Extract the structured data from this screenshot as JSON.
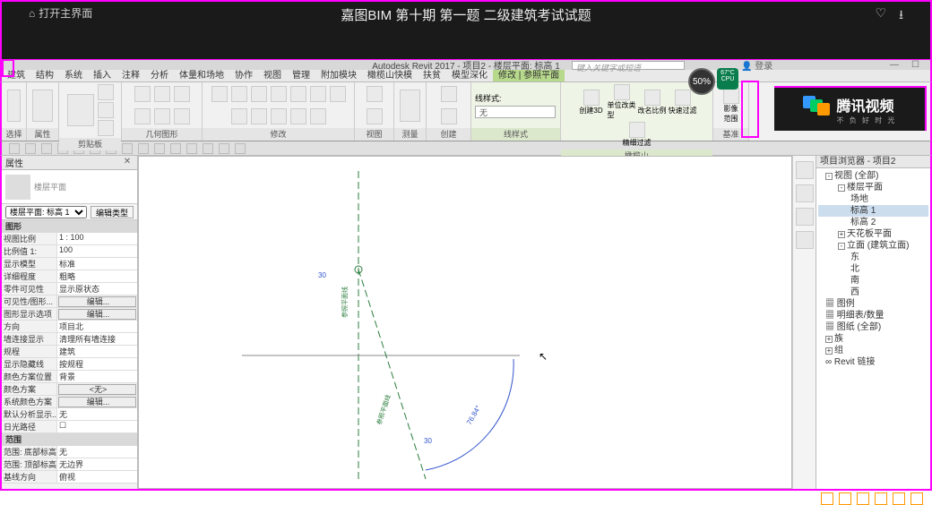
{
  "video": {
    "home_label": "打开主界面",
    "title": "嘉图BIM 第十期 第一题 二级建筑考试试题",
    "badge_pct": "50%",
    "cpu_label": "67°C CPU"
  },
  "tencent": {
    "brand": "腾讯视频",
    "slogan": "不 负 好 时 光"
  },
  "revit": {
    "app_title": "Autodesk Revit 2017 -  项目2 - 楼层平面: 标高 1",
    "search_placeholder": "键入关键字或短语",
    "login": "登录"
  },
  "tabs": [
    "建筑",
    "结构",
    "系统",
    "插入",
    "注释",
    "分析",
    "体量和场地",
    "协作",
    "视图",
    "管理",
    "附加模块",
    "橄榄山快模",
    "扶贫",
    "模型深化",
    "修改 | 参照平面"
  ],
  "active_tab_index": 14,
  "ribbon_panels": {
    "p0": "选择",
    "p1": "属性",
    "p2": "剪贴板",
    "p3": "几何图形",
    "p4": "修改",
    "p5": "视图",
    "p6": "测量",
    "p7": "创建",
    "linestyle_title": "线样式:",
    "linestyle_value": "无",
    "p8": "线样式",
    "b0": "创建3D",
    "b1": "单位改类型",
    "b2": "改名比例",
    "b3": "快速过滤",
    "b4": "精细过滤",
    "p9": "橄榄山",
    "b5": "影像",
    "b6": "范围",
    "p10": "基准"
  },
  "props": {
    "title": "属性",
    "type_name": "楼层平面",
    "instance_label": "楼层平面: 标高 1",
    "edit_type": "编辑类型",
    "section_graphics": "图形",
    "rows": [
      {
        "k": "视图比例",
        "v": "1 : 100"
      },
      {
        "k": "比例值 1:",
        "v": "100"
      },
      {
        "k": "显示模型",
        "v": "标准"
      },
      {
        "k": "详细程度",
        "v": "粗略"
      },
      {
        "k": "零件可见性",
        "v": "显示原状态"
      },
      {
        "k": "可见性/图形...",
        "v": "编辑...",
        "btn": true
      },
      {
        "k": "图形显示选项",
        "v": "编辑...",
        "btn": true
      },
      {
        "k": "方向",
        "v": "项目北"
      },
      {
        "k": "墙连接显示",
        "v": "清理所有墙连接"
      },
      {
        "k": "规程",
        "v": "建筑"
      },
      {
        "k": "显示隐藏线",
        "v": "按规程"
      },
      {
        "k": "颜色方案位置",
        "v": "背景"
      },
      {
        "k": "颜色方案",
        "v": "<无>",
        "btn": true
      },
      {
        "k": "系统颜色方案",
        "v": "编辑...",
        "btn": true
      },
      {
        "k": "默认分析显示...",
        "v": "无"
      },
      {
        "k": "日光路径",
        "v": "☐"
      }
    ],
    "section_extents": "范围",
    "rows2": [
      {
        "k": "范围: 底部标高",
        "v": "无"
      },
      {
        "k": "范围: 顶部标高",
        "v": "无边界"
      },
      {
        "k": "基线方向",
        "v": "俯视"
      }
    ]
  },
  "canvas": {
    "dim1": "30",
    "dim2": "30",
    "angle": "76.84°",
    "label_v": "参照平面线"
  },
  "browser": {
    "title": "项目浏览器 - 项目2",
    "nodes": [
      {
        "t": "视图 (全部)",
        "l": 0,
        "exp": "-"
      },
      {
        "t": "楼层平面",
        "l": 1,
        "exp": "-"
      },
      {
        "t": "场地",
        "l": 2
      },
      {
        "t": "标高 1",
        "l": 2,
        "sel": true
      },
      {
        "t": "标高 2",
        "l": 2
      },
      {
        "t": "天花板平面",
        "l": 1,
        "exp": "+"
      },
      {
        "t": "立面 (建筑立面)",
        "l": 1,
        "exp": "-"
      },
      {
        "t": "东",
        "l": 2
      },
      {
        "t": "北",
        "l": 2
      },
      {
        "t": "南",
        "l": 2
      },
      {
        "t": "西",
        "l": 2
      },
      {
        "t": "图例",
        "l": 0,
        "icon": "▦"
      },
      {
        "t": "明细表/数量",
        "l": 0,
        "icon": "▦"
      },
      {
        "t": "图纸 (全部)",
        "l": 0,
        "icon": "▦"
      },
      {
        "t": "族",
        "l": 0,
        "exp": "+"
      },
      {
        "t": "组",
        "l": 0,
        "exp": "+"
      },
      {
        "t": "Revit 链接",
        "l": 0,
        "icon": "∞"
      }
    ]
  }
}
